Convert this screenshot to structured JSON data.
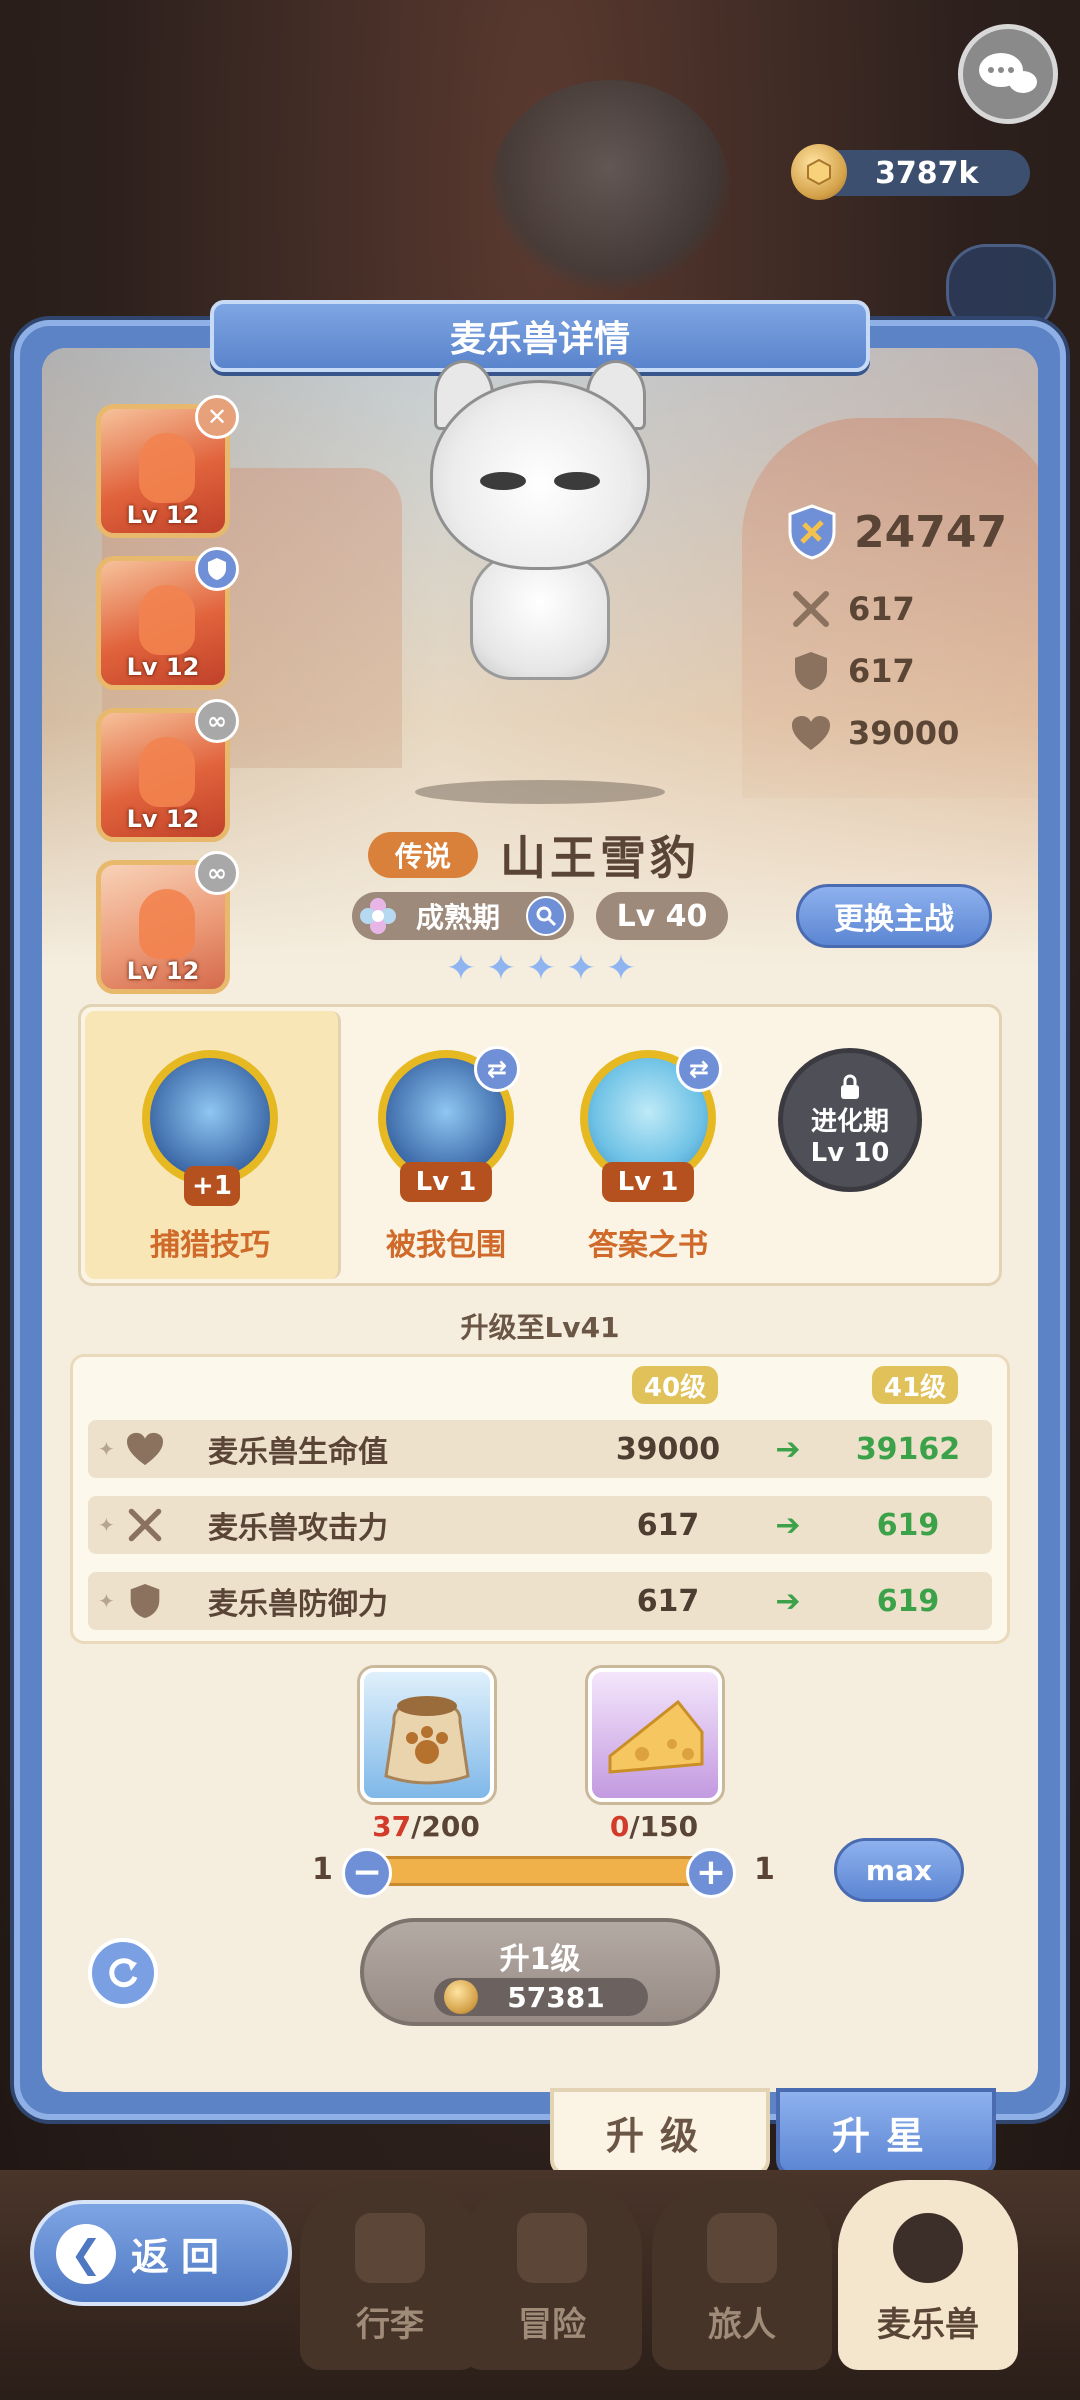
{
  "top": {
    "coins": "3787k"
  },
  "panel": {
    "title": "麦乐兽详情"
  },
  "party": [
    {
      "level": "Lv 12",
      "badge": "x-icon",
      "badge_color": "#e6a07a"
    },
    {
      "level": "Lv 12",
      "badge": "shield-icon",
      "badge_color": "#6f8fd6"
    },
    {
      "level": "Lv 12",
      "badge": "link-icon",
      "badge_color": "#a8a8a8"
    },
    {
      "level": "Lv 12",
      "badge": "link-icon",
      "badge_color": "#a8a8a8"
    }
  ],
  "stats": {
    "power": "24747",
    "attack": "617",
    "defense": "617",
    "hp": "39000"
  },
  "pet": {
    "rarity": "传说",
    "name": "山王雪豹",
    "stage": "成熟期",
    "level": "Lv 40",
    "switch_label": "更换主战",
    "stars": 5
  },
  "skills": [
    {
      "name": "捕猎技巧",
      "level": "+1"
    },
    {
      "name": "被我包围",
      "level": "Lv 1"
    },
    {
      "name": "答案之书",
      "level": "Lv 1"
    }
  ],
  "locked_skill": {
    "line1": "进化期",
    "line2": "Lv 10"
  },
  "upgrade": {
    "title": "升级至Lv41",
    "col_current": "40级",
    "col_next": "41级",
    "rows": [
      {
        "label": "麦乐兽生命值",
        "current": "39000",
        "next": "39162",
        "icon": "heart-icon"
      },
      {
        "label": "麦乐兽攻击力",
        "current": "617",
        "next": "619",
        "icon": "swords-icon"
      },
      {
        "label": "麦乐兽防御力",
        "current": "617",
        "next": "619",
        "icon": "shield-icon"
      }
    ]
  },
  "materials": [
    {
      "have": "37",
      "need": "/200",
      "icon": "food-bag-icon"
    },
    {
      "have": "0",
      "need": "/150",
      "icon": "cheese-icon"
    }
  ],
  "slider": {
    "min": "1",
    "max": "1",
    "max_label": "max"
  },
  "upgrade_button": {
    "label": "升1级",
    "cost": "57381"
  },
  "tabs": {
    "upgrade": "升级",
    "star": "升星"
  },
  "nav": {
    "back": "返回",
    "items": [
      "行李",
      "冒险",
      "旅人",
      "麦乐兽"
    ]
  },
  "colors": {
    "accent_blue": "#5c86d3",
    "gold": "#e1c25a",
    "increase_green": "#3ba24a",
    "shortage_red": "#d23a2a"
  }
}
